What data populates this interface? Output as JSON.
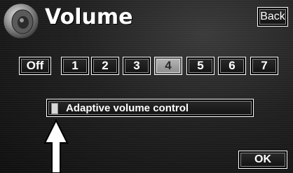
{
  "header": {
    "title": "Volume",
    "back_label": "Back",
    "icon": "speaker-icon"
  },
  "volume_levels": {
    "options": [
      "Off",
      "1",
      "2",
      "3",
      "4",
      "5",
      "6",
      "7"
    ],
    "selected": "4"
  },
  "adaptive_volume": {
    "label": "Adaptive volume control",
    "indicator_on": false
  },
  "footer": {
    "ok_label": "OK"
  },
  "annotation": {
    "icon": "up-arrow-icon"
  },
  "colors": {
    "background": "#1c1c1c",
    "text": "#ffffff",
    "selected_button": "#a0a0a0",
    "border": "#ffffff"
  }
}
